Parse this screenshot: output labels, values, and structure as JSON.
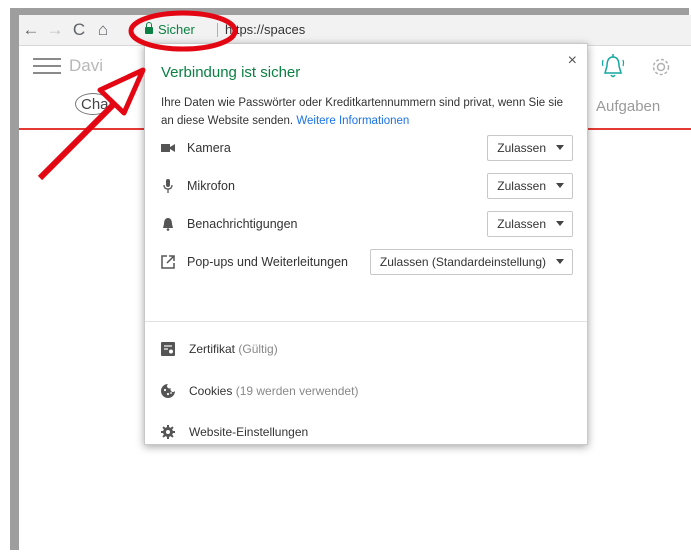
{
  "browser": {
    "secure_label": "Sicher",
    "url": "https://spaces"
  },
  "site": {
    "user_name": "Davi",
    "tab_chat": "Chat",
    "tab_tasks": "Aufgaben"
  },
  "popup": {
    "title": "Verbindung ist sicher",
    "description": "Ihre Daten wie Passwörter oder Kreditkartennummern sind privat, wenn Sie sie an diese Website senden.",
    "more_info_link": "Weitere Informationen",
    "close_glyph": "×",
    "permissions": [
      {
        "label": "Kamera",
        "value": "Zulassen",
        "icon": "camera-icon"
      },
      {
        "label": "Mikrofon",
        "value": "Zulassen",
        "icon": "microphone-icon"
      },
      {
        "label": "Benachrichtigungen",
        "value": "Zulassen",
        "icon": "bell-icon"
      },
      {
        "label": "Pop-ups und Weiterleitungen",
        "value": "Zulassen (Standardeinstellung)",
        "icon": "popup-icon"
      }
    ],
    "certificate": {
      "label": "Zertifikat",
      "status": "(Gültig)"
    },
    "cookies": {
      "label": "Cookies",
      "status": "(19 werden verwendet)"
    },
    "site_settings": "Website-Einstellungen"
  },
  "colors": {
    "secure_green": "#0b8043",
    "link_blue": "#1a73e8",
    "annotation_red": "#e30613",
    "tab_underline": "#e53935"
  }
}
